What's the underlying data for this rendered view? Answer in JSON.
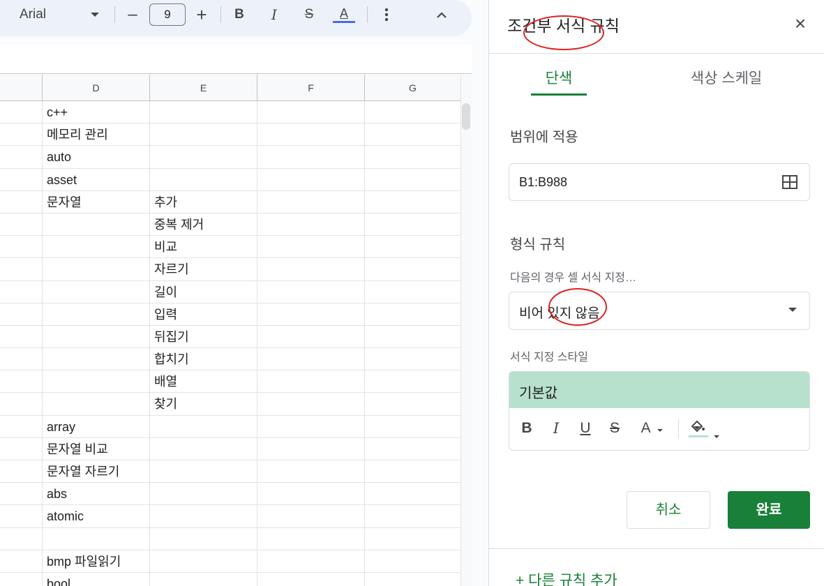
{
  "toolbar": {
    "font_name": "Arial",
    "font_size": "9",
    "minus_label": "–",
    "plus_label": "+",
    "bold_label": "B",
    "italic_label": "I",
    "strike_label": "S",
    "text_color_label": "A",
    "text_color_bar": "#4a6ee0",
    "more_icon": "more-vertical-icon",
    "collapse_icon": "chevron-up-icon"
  },
  "grid": {
    "column_headers": [
      "D",
      "E",
      "F",
      "G"
    ],
    "rows": [
      [
        "c++",
        ""
      ],
      [
        "메모리 관리",
        ""
      ],
      [
        "auto",
        ""
      ],
      [
        "asset",
        ""
      ],
      [
        "문자열",
        "추가"
      ],
      [
        "",
        "중복 제거"
      ],
      [
        "",
        "비교"
      ],
      [
        "",
        "자르기"
      ],
      [
        "",
        "길이"
      ],
      [
        "",
        "입력"
      ],
      [
        "",
        "뒤집기"
      ],
      [
        "",
        "합치기"
      ],
      [
        "",
        "배열"
      ],
      [
        "",
        "찾기"
      ],
      [
        "array",
        ""
      ],
      [
        "문자열 비교",
        ""
      ],
      [
        "문자열 자르기",
        ""
      ],
      [
        "abs",
        ""
      ],
      [
        "atomic",
        ""
      ],
      [
        "",
        ""
      ],
      [
        "bmp 파일읽기",
        ""
      ],
      [
        "bool",
        ""
      ]
    ]
  },
  "panel": {
    "title": "조건부 서식 규칙",
    "close_label": "×",
    "tabs": [
      {
        "label": "단색",
        "active": true
      },
      {
        "label": "색상 스케일",
        "active": false
      }
    ],
    "range_label": "범위에 적용",
    "range_value": "B1:B988",
    "rules_label": "형식 규칙",
    "condition_label": "다음의 경우 셀 서식 지정…",
    "condition_value": "비어 있지 않음",
    "style_label": "서식 지정 스타일",
    "style_preview": "기본값",
    "style_preview_color": "#b7e1cd",
    "style_buttons": {
      "bold": "B",
      "italic": "I",
      "underline": "U",
      "strike": "S",
      "text_color": "A"
    },
    "cancel_label": "취소",
    "done_label": "완료",
    "add_rule_label": "+  다른 규칙 추가",
    "accent_color": "#188038"
  }
}
